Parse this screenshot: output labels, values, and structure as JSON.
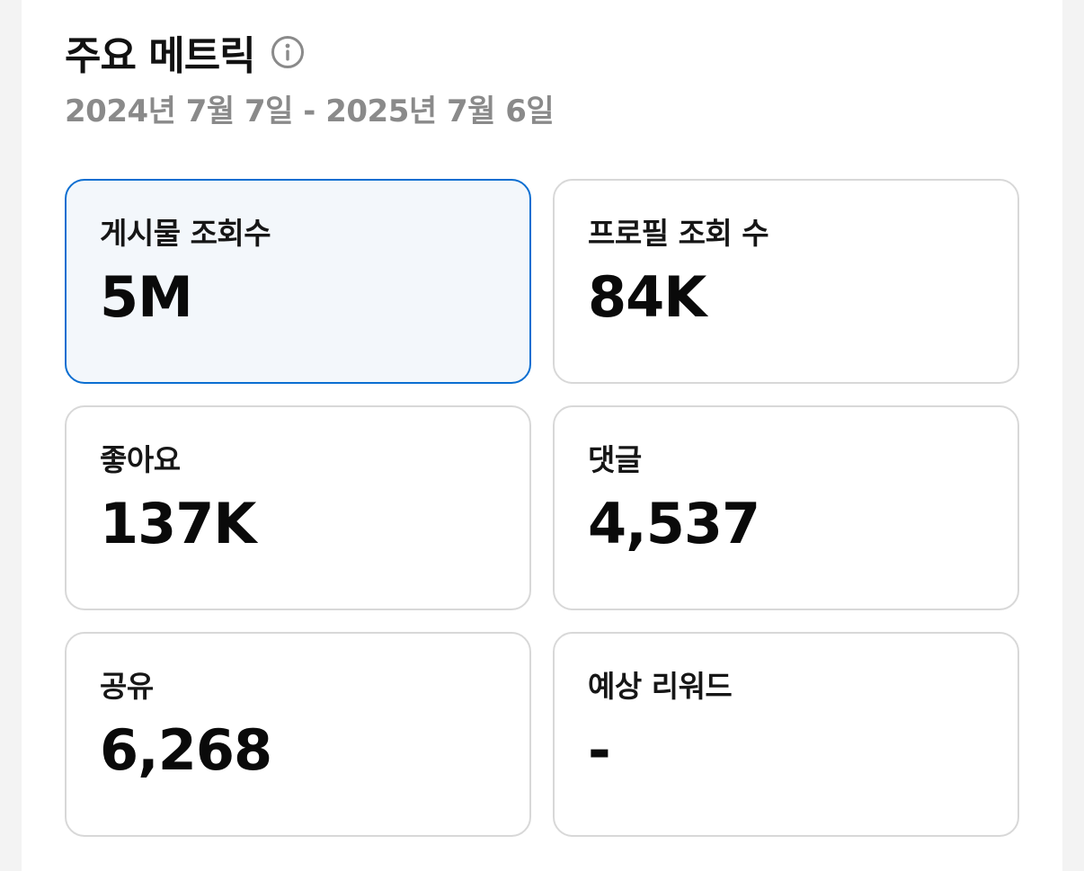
{
  "header": {
    "title": "주요 메트릭",
    "date_range": "2024년 7월 7일 - 2025년 7월 6일"
  },
  "icons": {
    "info": "info-icon"
  },
  "colors": {
    "selected_border": "#0a6ed1",
    "selected_background": "#f3f7fb",
    "card_border": "#d8d8d8",
    "subtitle": "#8a8a8a"
  },
  "metrics": [
    {
      "label": "게시물 조회수",
      "value": "5M",
      "selected": true
    },
    {
      "label": "프로필 조회 수",
      "value": "84K",
      "selected": false
    },
    {
      "label": "좋아요",
      "value": "137K",
      "selected": false
    },
    {
      "label": "댓글",
      "value": "4,537",
      "selected": false
    },
    {
      "label": "공유",
      "value": "6,268",
      "selected": false
    },
    {
      "label": "예상 리워드",
      "value": "-",
      "selected": false
    }
  ]
}
